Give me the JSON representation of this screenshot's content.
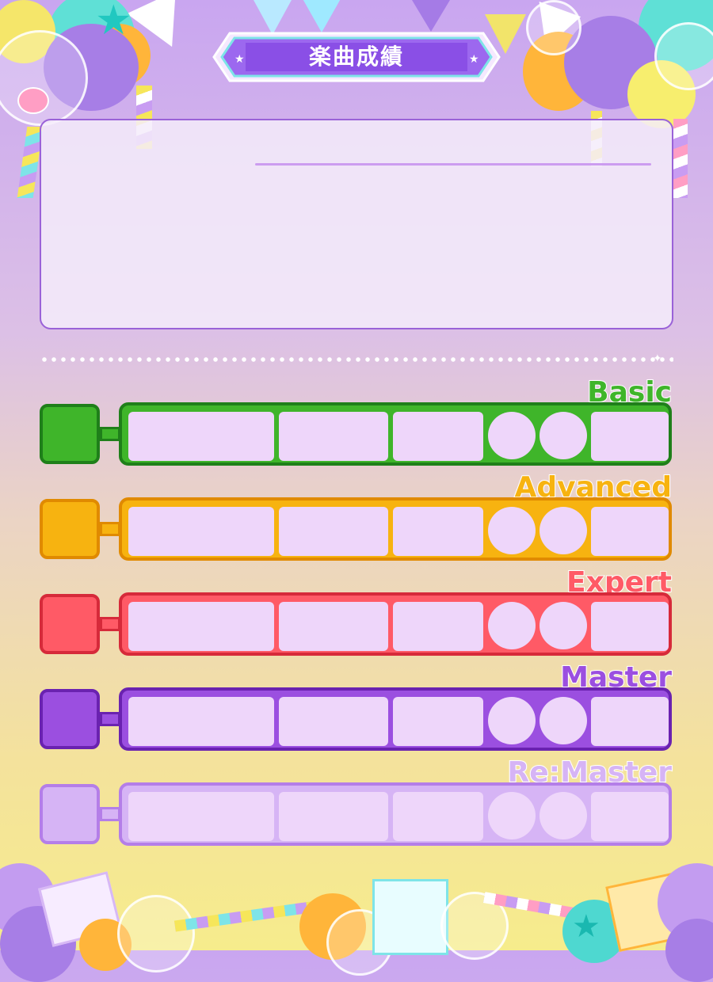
{
  "title": "楽曲成績",
  "difficulties": [
    {
      "label": "Basic",
      "color": "#3fb52a",
      "dark": "#1f7f1a"
    },
    {
      "label": "Advanced",
      "color": "#f7b310",
      "dark": "#e08a00"
    },
    {
      "label": "Expert",
      "color": "#ff5a66",
      "dark": "#d62a3a"
    },
    {
      "label": "Master",
      "color": "#9b4fe0",
      "dark": "#6a22b0"
    },
    {
      "label": "Re:Master",
      "color": "#d6b4f5",
      "dark": "#b47ee8"
    }
  ],
  "colors": {
    "panel_border": "#9a62d8",
    "cell_fill": "#eed6fa",
    "title_band": "#8a4fe6"
  }
}
